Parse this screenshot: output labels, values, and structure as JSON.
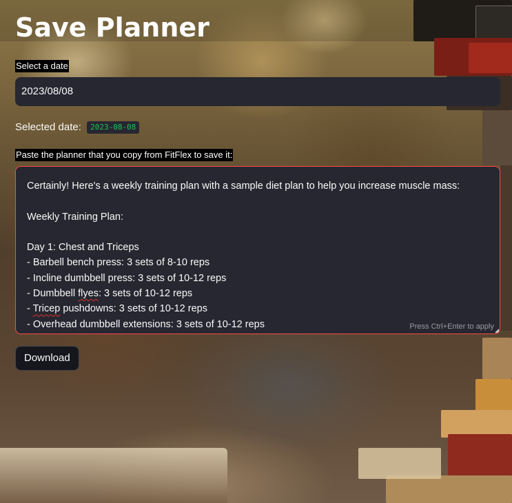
{
  "page": {
    "title": "Save Planner"
  },
  "date_picker": {
    "label": "Select a date",
    "value": "2023/08/08"
  },
  "selected_date": {
    "prefix": "Selected date:",
    "code": "2023-08-08"
  },
  "planner_input": {
    "label": "Paste the planner that you copy from FitFlex to save it:",
    "lines": [
      "Certainly! Here's a weekly training plan with a sample diet plan to help you increase muscle mass:",
      "",
      "Weekly Training Plan:",
      "",
      "Day 1: Chest and Triceps",
      "- Barbell bench press: 3 sets of 8-10 reps",
      "- Incline dumbbell press: 3 sets of 10-12 reps",
      "- Dumbbell flyes: 3 sets of 10-12 reps",
      "- Tricep pushdowns: 3 sets of 10-12 reps",
      "- Overhead dumbbell extensions: 3 sets of 10-12 reps"
    ],
    "hint": "Press Ctrl+Enter to apply"
  },
  "download": {
    "label": "Download"
  },
  "colors": {
    "input_bg": "#262730",
    "error_border": "#ff4b4b",
    "code_green": "#21c354"
  }
}
